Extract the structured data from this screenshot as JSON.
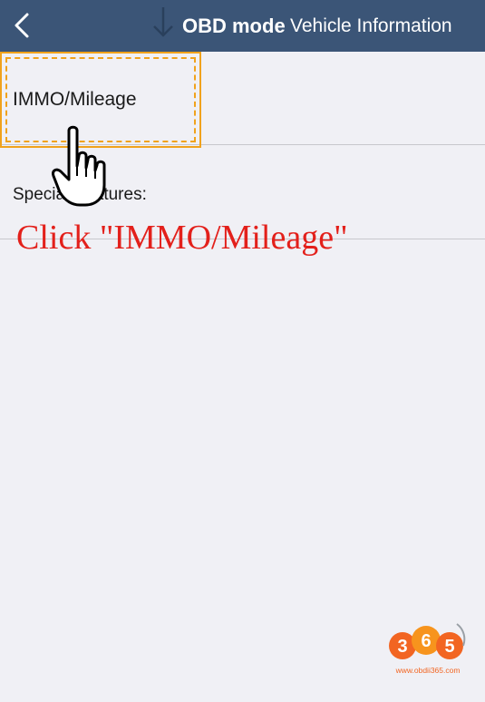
{
  "navbar": {
    "mode_label": "OBD mode",
    "title": "Vehicle Information",
    "background_color": "#3b5577",
    "back_icon": "chevron-left-icon"
  },
  "list": {
    "item_label": "IMMO/Mileage"
  },
  "special_features": {
    "label": "Special Features:"
  },
  "annotation": {
    "text": "Click  \"IMMO/Mileage\"",
    "color": "#e3201b",
    "highlight_color": "#f0a21c",
    "pointer_icon": "hand-pointer-icon"
  },
  "watermark": {
    "url": "www.obdii365.com"
  }
}
